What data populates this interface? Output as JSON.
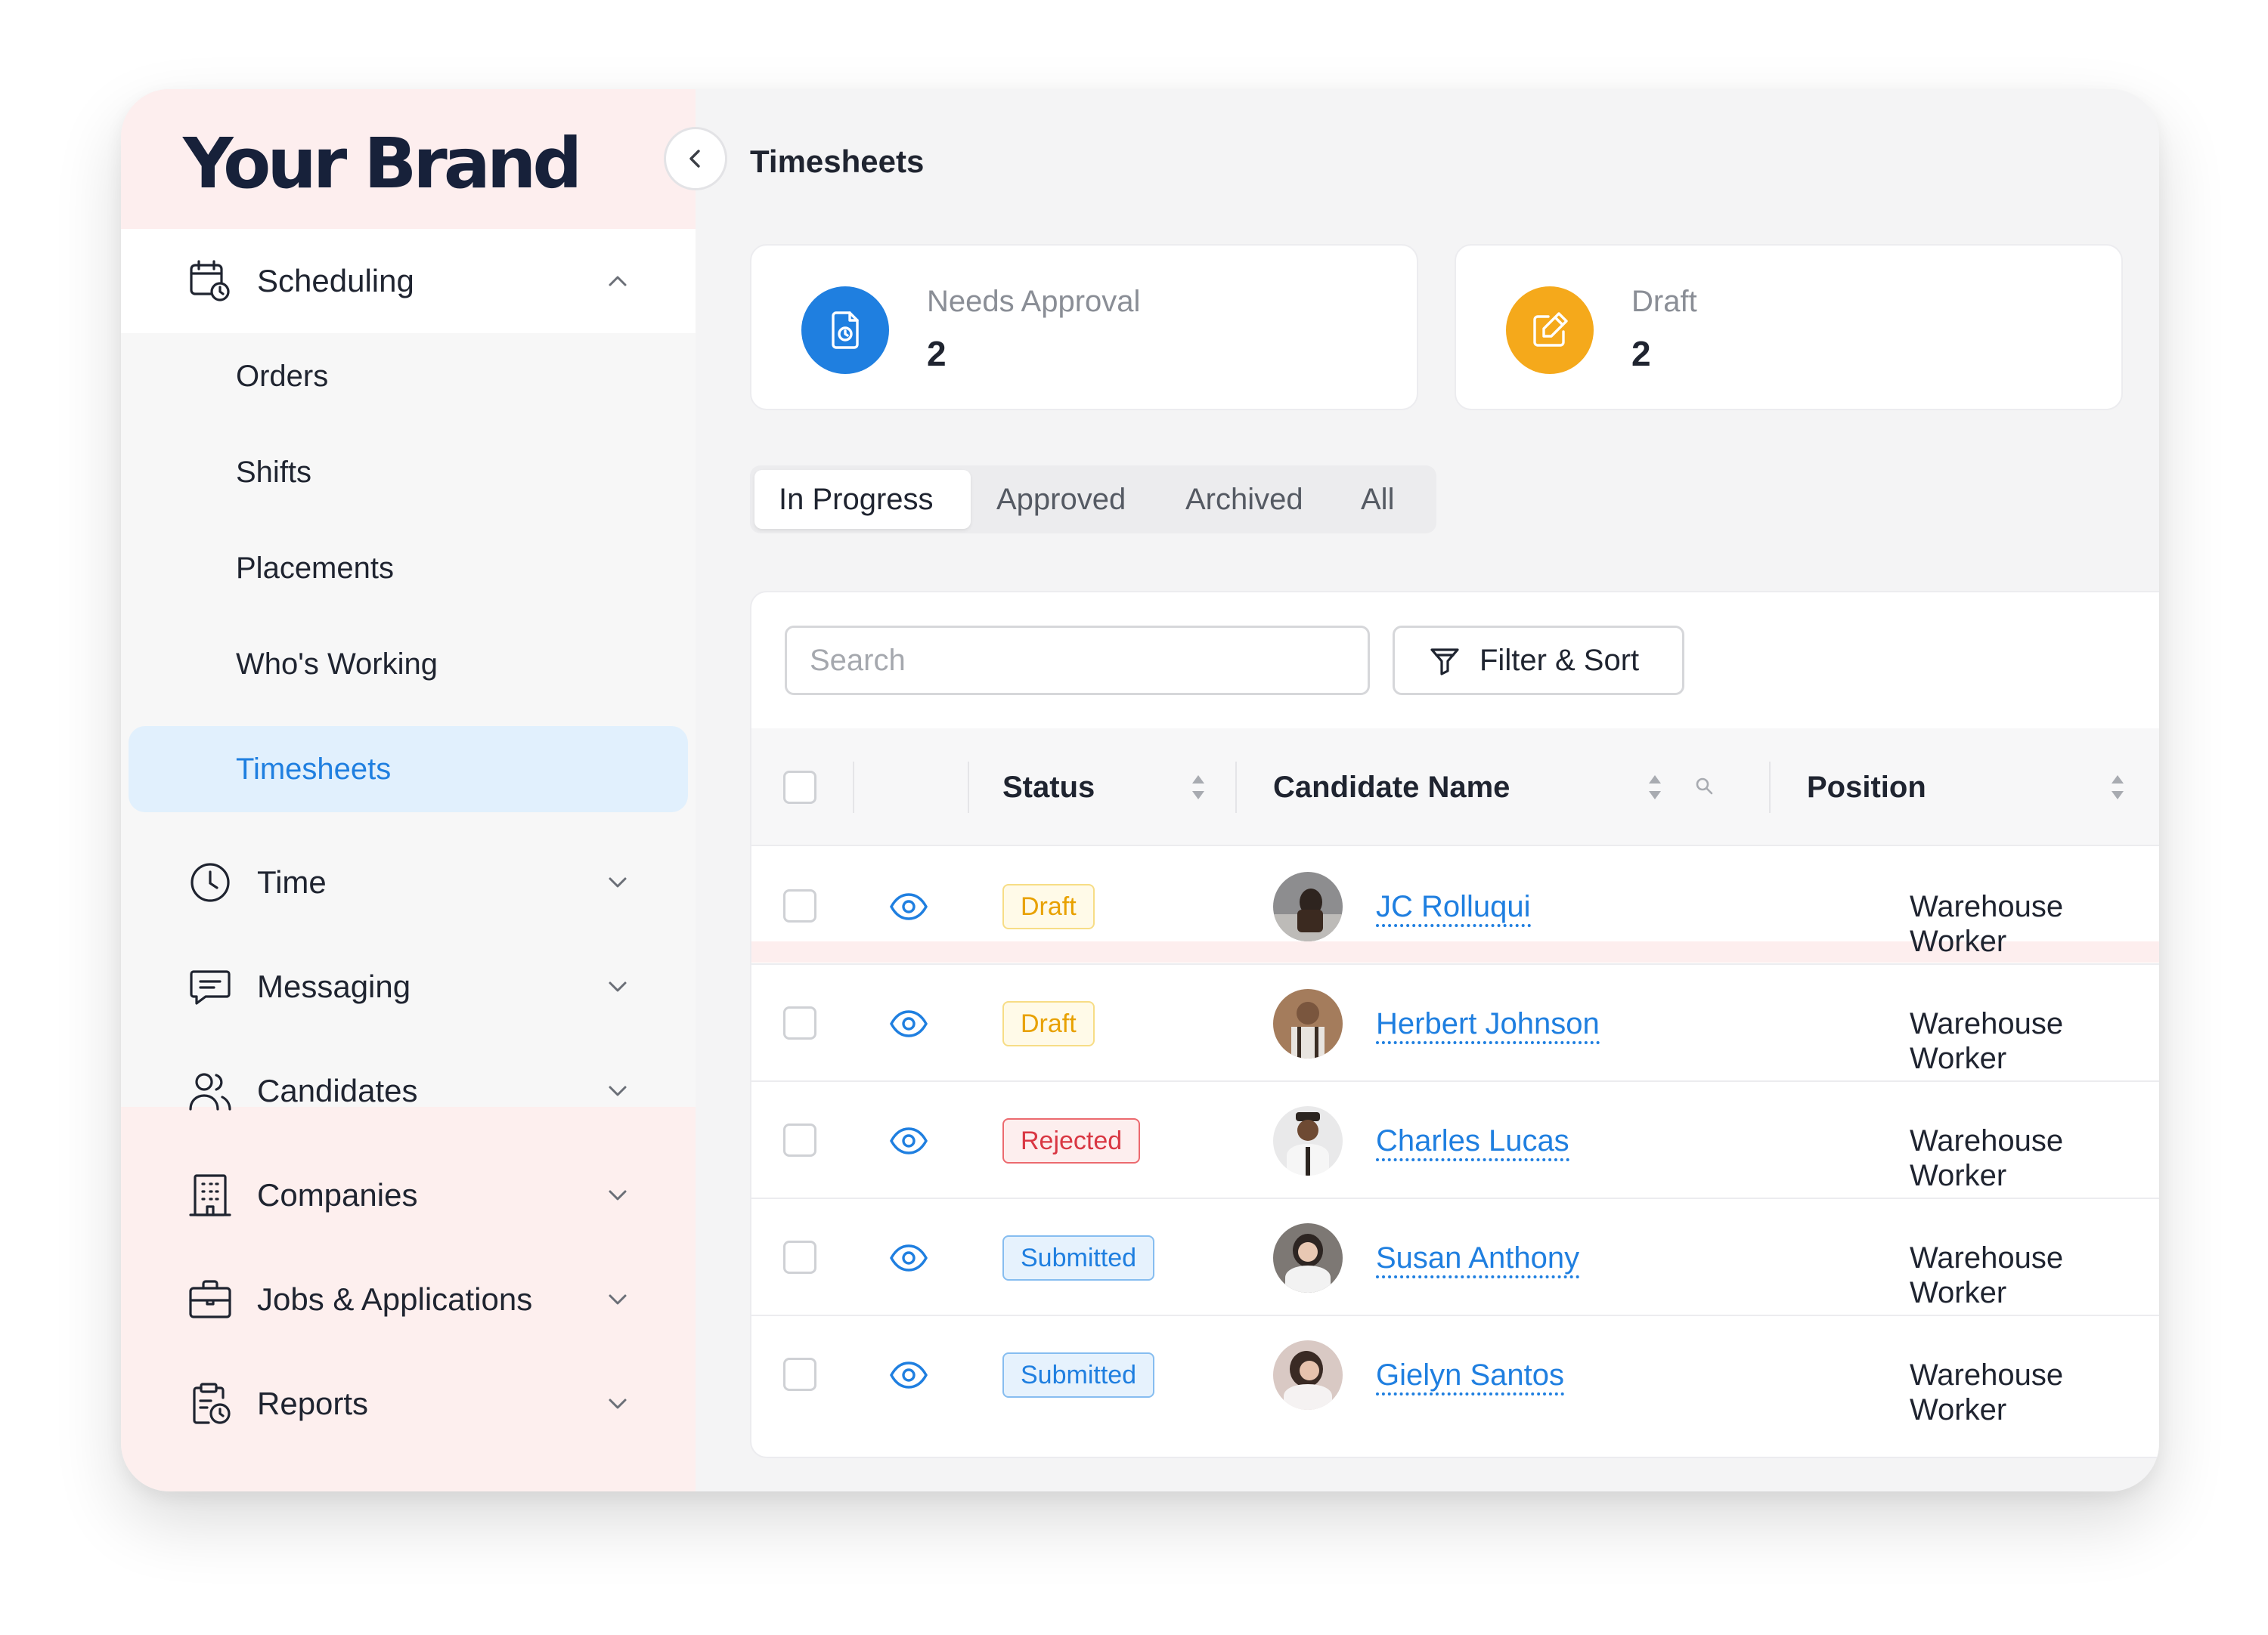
{
  "brand": {
    "name": "Your Brand"
  },
  "sidebar": {
    "scheduling": {
      "label": "Scheduling",
      "expanded": true,
      "items": [
        {
          "label": "Orders"
        },
        {
          "label": "Shifts"
        },
        {
          "label": "Placements"
        },
        {
          "label": "Who's Working"
        },
        {
          "label": "Timesheets",
          "active": true
        }
      ]
    },
    "sections": [
      {
        "label": "Time",
        "icon": "clock-icon"
      },
      {
        "label": "Messaging",
        "icon": "message-icon"
      },
      {
        "label": "Candidates",
        "icon": "users-icon"
      },
      {
        "label": "Companies",
        "icon": "building-icon"
      },
      {
        "label": "Jobs & Applications",
        "icon": "briefcase-icon"
      },
      {
        "label": "Reports",
        "icon": "clipboard-clock-icon"
      }
    ]
  },
  "header": {
    "title": "Timesheets"
  },
  "stats": [
    {
      "label": "Needs Approval",
      "value": "2",
      "color": "#1f7fe0",
      "icon": "document-clock-icon"
    },
    {
      "label": "Draft",
      "value": "2",
      "color": "#f5a91b",
      "icon": "edit-icon"
    }
  ],
  "tabs": [
    {
      "label": "In Progress",
      "active": true
    },
    {
      "label": "Approved"
    },
    {
      "label": "Archived"
    },
    {
      "label": "All"
    }
  ],
  "toolbar": {
    "search_placeholder": "Search",
    "filter_label": "Filter & Sort"
  },
  "table": {
    "columns": {
      "status": "Status",
      "candidate": "Candidate Name",
      "position": "Position"
    },
    "rows": [
      {
        "status": "Draft",
        "status_type": "draft",
        "candidate": "JC Rolluqui",
        "position": "Warehouse Worker"
      },
      {
        "status": "Draft",
        "status_type": "draft",
        "candidate": "Herbert Johnson",
        "position": "Warehouse Worker"
      },
      {
        "status": "Rejected",
        "status_type": "rejected",
        "candidate": "Charles Lucas",
        "position": "Warehouse Worker"
      },
      {
        "status": "Submitted",
        "status_type": "submitted",
        "candidate": "Susan Anthony",
        "position": "Warehouse Worker"
      },
      {
        "status": "Submitted",
        "status_type": "submitted",
        "candidate": "Gielyn Santos",
        "position": "Warehouse Worker"
      }
    ]
  },
  "colors": {
    "accent": "#1f7fe0",
    "sidebar_bg": "#fdefee",
    "active_nav_bg": "#e1f0fd"
  }
}
